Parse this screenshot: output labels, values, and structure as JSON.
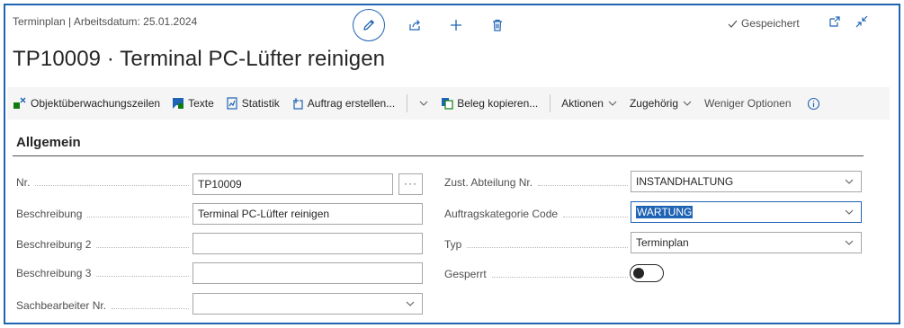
{
  "header": {
    "breadcrumb": "Terminplan | Arbeitsdatum: 25.01.2024",
    "status": "Gespeichert",
    "title": "TP10009 · Terminal PC-Lüfter reinigen"
  },
  "actions": {
    "objektueberwachung": "Objektüberwachungszeilen",
    "texte": "Texte",
    "statistik": "Statistik",
    "auftrag_erstellen": "Auftrag erstellen...",
    "beleg_kopieren": "Beleg kopieren...",
    "aktionen": "Aktionen",
    "zugehoerig": "Zugehörig",
    "weniger_optionen": "Weniger Optionen"
  },
  "section": {
    "title": "Allgemein"
  },
  "fields": {
    "nr_label": "Nr.",
    "nr_value": "TP10009",
    "nr_ellipsis": "···",
    "beschreibung_label": "Beschreibung",
    "beschreibung_value": "Terminal PC-Lüfter reinigen",
    "beschreibung2_label": "Beschreibung 2",
    "beschreibung2_value": "",
    "beschreibung3_label": "Beschreibung 3",
    "beschreibung3_value": "",
    "sachbearbeiter_label": "Sachbearbeiter Nr.",
    "sachbearbeiter_value": "",
    "abteilung_label": "Zust. Abteilung Nr.",
    "abteilung_value": "INSTANDHALTUNG",
    "kategorie_label": "Auftragskategorie Code",
    "kategorie_value": "WARTUNG",
    "typ_label": "Typ",
    "typ_value": "Terminplan",
    "gesperrt_label": "Gesperrt",
    "gesperrt_on": false
  },
  "colors": {
    "accent": "#1f63b4",
    "dark": "#262626",
    "green": "#107c10"
  }
}
